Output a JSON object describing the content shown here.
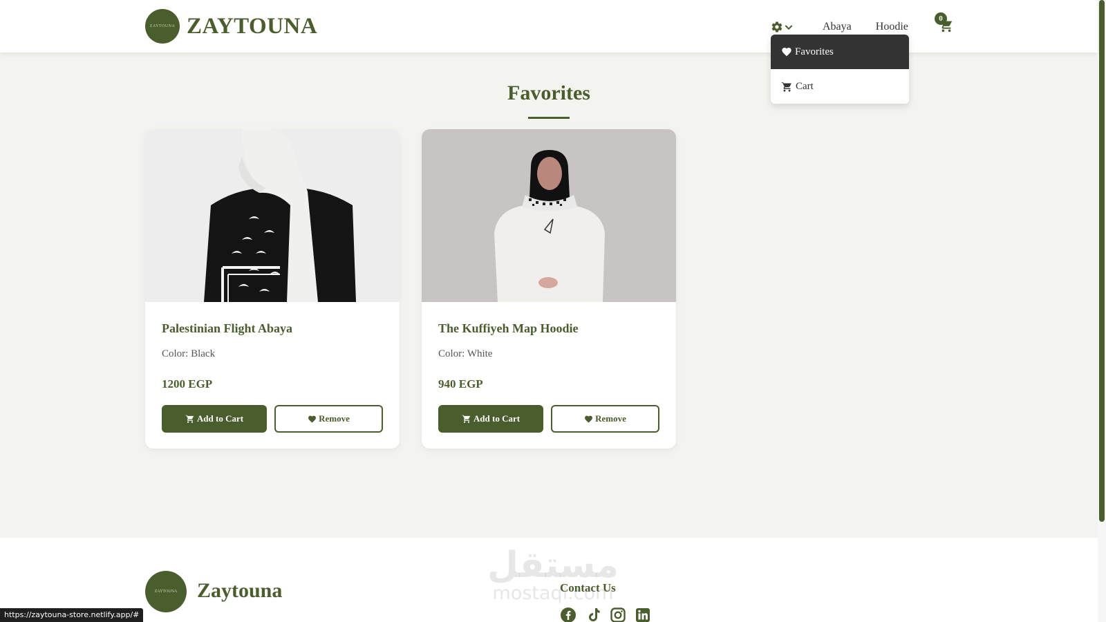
{
  "header": {
    "brand": "ZAYTOUNA",
    "logo_text": "ZAYTOUNA",
    "nav": [
      "Abaya",
      "Hoodie"
    ],
    "cart_count": "0"
  },
  "dropdown": {
    "items": [
      "Favorites",
      "Cart"
    ]
  },
  "page_title": "Favorites",
  "products": [
    {
      "name": "Palestinian Flight Abaya",
      "color": "Color: Black",
      "price": "1200 EGP",
      "add_label": "Add to Cart",
      "remove_label": "Remove"
    },
    {
      "name": "The Kuffiyeh Map Hoodie",
      "color": "Color: White",
      "price": "940 EGP",
      "add_label": "Add to Cart",
      "remove_label": "Remove"
    }
  ],
  "footer": {
    "brand": "Zaytouna",
    "contact_title": "Contact Us",
    "social": [
      "facebook-icon",
      "tiktok-icon",
      "instagram-icon",
      "linkedin-icon"
    ]
  },
  "watermark": {
    "ar": "مستقل",
    "en": "mostaql.com"
  },
  "status_url": "https://zaytouna-store.netlify.app/#",
  "colors": {
    "accent": "#4a5d2c",
    "background": "#f3f3ef"
  }
}
